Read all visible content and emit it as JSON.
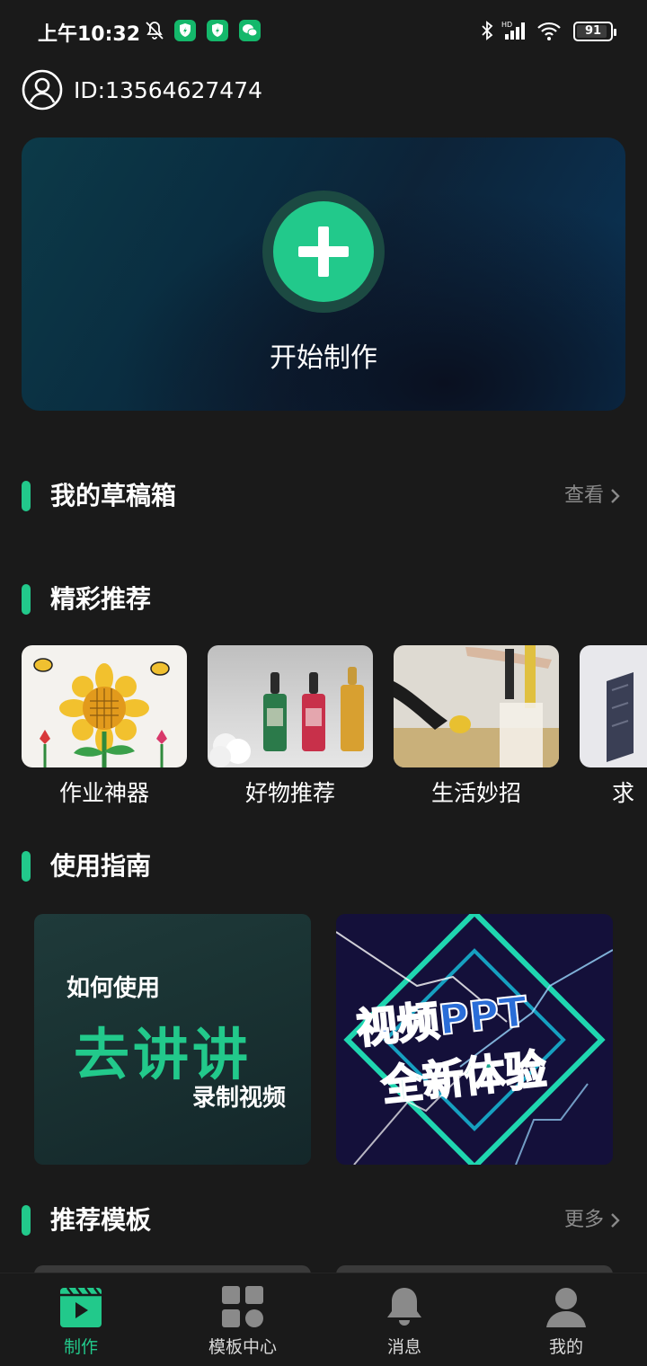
{
  "status_bar": {
    "time": "上午10:32",
    "battery": "91",
    "battery_level": 0.91,
    "signal_label": "HD",
    "icons": [
      "mute-icon",
      "security-app-icon",
      "security-app-icon",
      "wechat-icon",
      "bluetooth-icon",
      "signal-icon",
      "wifi-icon",
      "battery-icon"
    ]
  },
  "header": {
    "id_text": "ID:13564627474",
    "avatar_icon": "user-circle-icon"
  },
  "hero": {
    "label": "开始制作",
    "icon": "plus-icon"
  },
  "sections": {
    "drafts": {
      "title": "我的草稿箱",
      "more": "查看"
    },
    "recommend": {
      "title": "精彩推荐"
    },
    "guide": {
      "title": "使用指南"
    },
    "templates": {
      "title": "推荐模板",
      "more": "更多"
    }
  },
  "recommend_items": [
    {
      "label": "作业神器"
    },
    {
      "label": "好物推荐"
    },
    {
      "label": "生活妙招"
    },
    {
      "label": "求"
    }
  ],
  "guides": [
    {
      "line1": "如何使用",
      "line2": "去讲讲",
      "line3": "录制视频"
    },
    {
      "line1": "视频PPT",
      "line2": "全新体验"
    }
  ],
  "bottom_nav": [
    {
      "label": "制作",
      "icon": "video-clapper-icon",
      "active": true
    },
    {
      "label": "模板中心",
      "icon": "grid-icon",
      "active": false
    },
    {
      "label": "消息",
      "icon": "bell-icon",
      "active": false
    },
    {
      "label": "我的",
      "icon": "person-icon",
      "active": false
    }
  ],
  "colors": {
    "accent": "#22c98b",
    "background": "#1a1a1a",
    "muted_text": "#8a8a8a"
  }
}
